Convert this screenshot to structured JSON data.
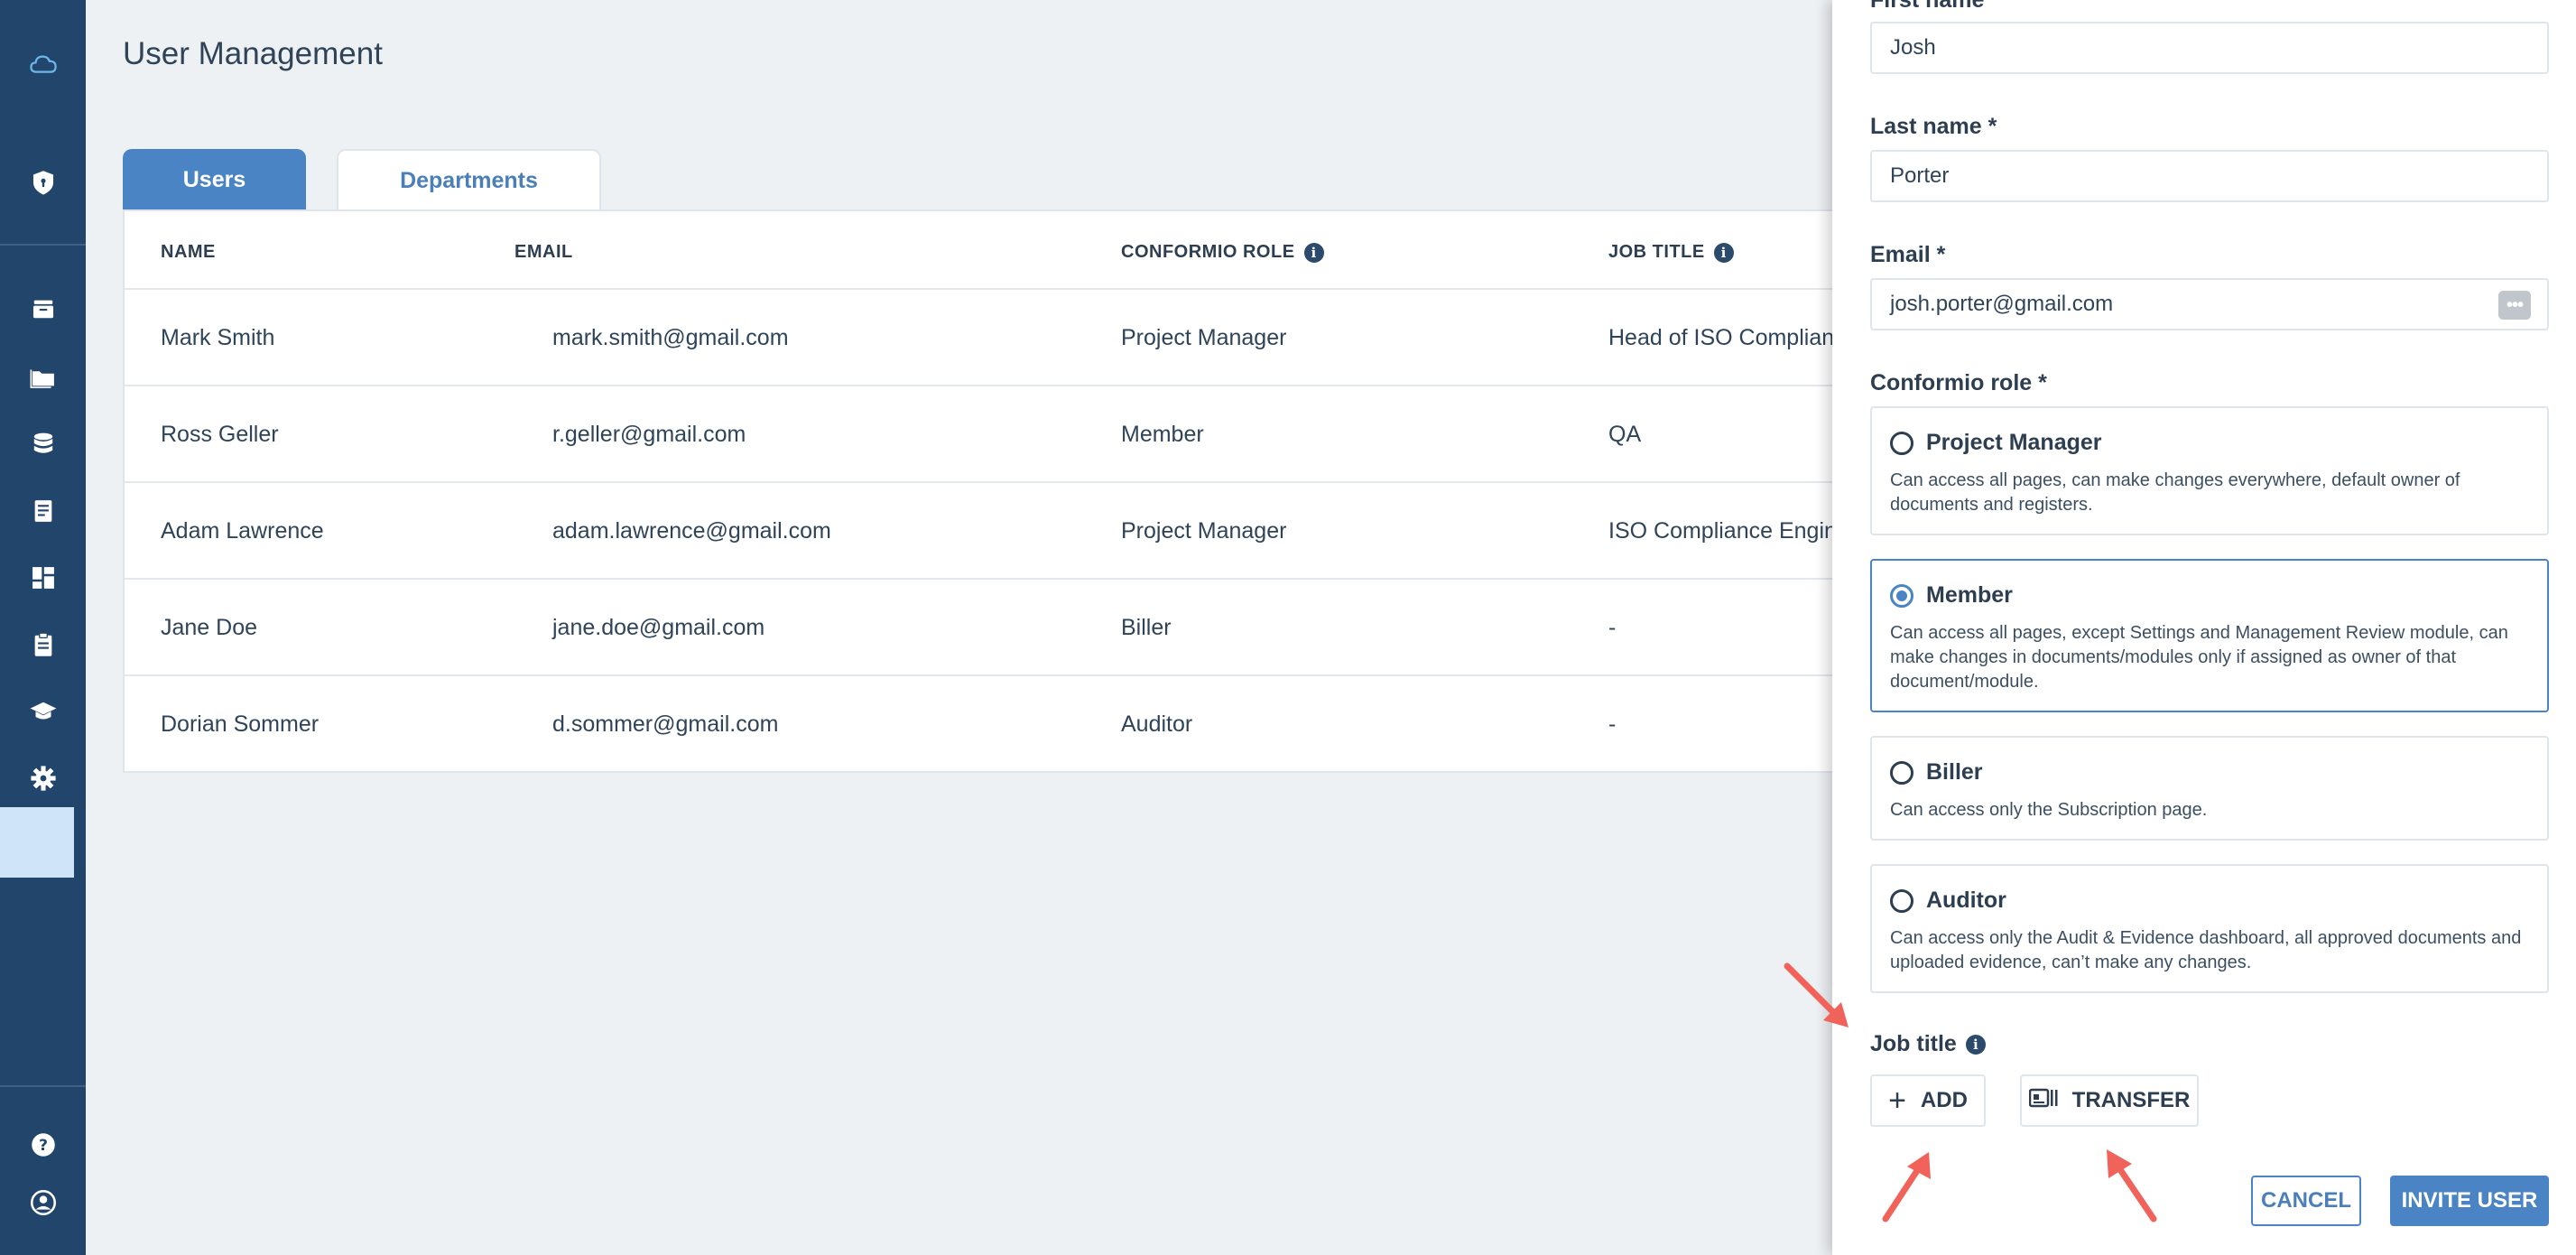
{
  "sidebar": {
    "items": [
      {
        "icon": "cloud-logo-icon"
      },
      {
        "icon": "shield-icon"
      },
      {
        "icon": "archive-box-icon"
      },
      {
        "icon": "folder-icon"
      },
      {
        "icon": "database-icon"
      },
      {
        "icon": "document-icon"
      },
      {
        "icon": "dashboard-icon"
      },
      {
        "icon": "clipboard-icon"
      },
      {
        "icon": "graduation-cap-icon"
      },
      {
        "icon": "gear-icon"
      },
      {
        "icon": "help-icon"
      },
      {
        "icon": "account-icon"
      }
    ]
  },
  "page": {
    "title": "User Management",
    "tabs": [
      "Users",
      "Departments"
    ],
    "active_tab": "Users"
  },
  "table": {
    "columns": [
      "NAME",
      "EMAIL",
      "CONFORMIO ROLE",
      "JOB TITLE"
    ],
    "rows": [
      {
        "name": "Mark Smith",
        "email": "mark.smith@gmail.com",
        "role": "Project Manager",
        "job_title": "Head of ISO Compliance"
      },
      {
        "name": "Ross Geller",
        "email": "r.geller@gmail.com",
        "role": "Member",
        "job_title": "QA"
      },
      {
        "name": "Adam Lawrence",
        "email": "adam.lawrence@gmail.com",
        "role": "Project Manager",
        "job_title": "ISO Compliance Engineer"
      },
      {
        "name": "Jane Doe",
        "email": "jane.doe@gmail.com",
        "role": "Biller",
        "job_title": "-"
      },
      {
        "name": "Dorian Sommer",
        "email": "d.sommer@gmail.com",
        "role": "Auditor",
        "job_title": "-"
      }
    ]
  },
  "panel": {
    "first_name_label": "First name *",
    "first_name_value": "Josh",
    "last_name_label": "Last name *",
    "last_name_value": "Porter",
    "email_label": "Email *",
    "email_value": "josh.porter@gmail.com",
    "role_label": "Conformio role *",
    "roles": [
      {
        "title": "Project Manager",
        "desc": "Can access all pages, can make changes everywhere, default owner of documents and registers.",
        "selected": false
      },
      {
        "title": "Member",
        "desc": "Can access all pages, except Settings and Management Review module, can make changes in documents/modules only if assigned as owner of that document/module.",
        "selected": true
      },
      {
        "title": "Biller",
        "desc": "Can access only the Subscription page.",
        "selected": false
      },
      {
        "title": "Auditor",
        "desc": "Can access only the Audit & Evidence dashboard, all approved documents and uploaded evidence, can’t make any changes.",
        "selected": false
      }
    ],
    "job_title_label": "Job title",
    "add_label": "ADD",
    "transfer_label": "TRANSFER",
    "cancel_label": "CANCEL",
    "invite_label": "INVITE USER"
  },
  "colors": {
    "sidebar": "#22456b",
    "accent": "#4a84c4",
    "annotation_arrow": "#f0625a"
  }
}
